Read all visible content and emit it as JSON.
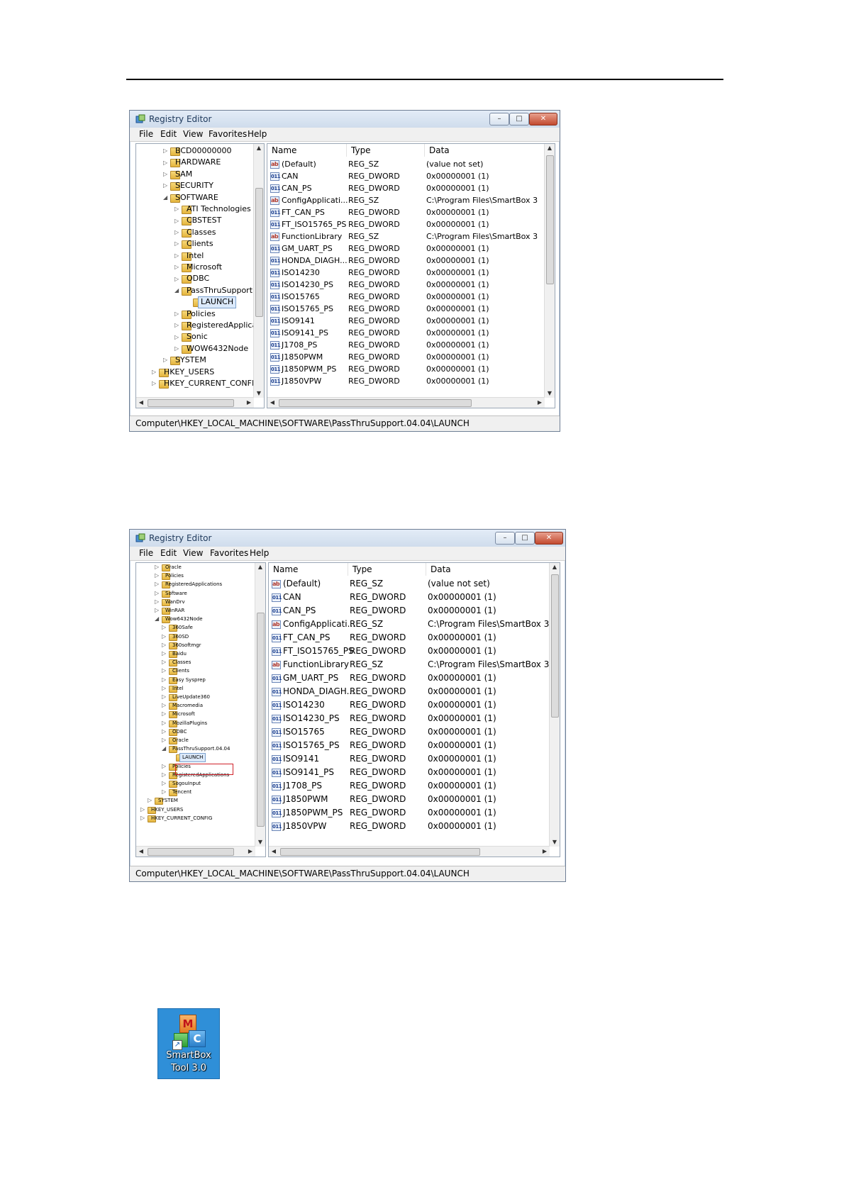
{
  "window_title": "Registry Editor",
  "window_buttons": {
    "minimize": "–",
    "maximize": "□",
    "close": "✕"
  },
  "menu": [
    "File",
    "Edit",
    "View",
    "Favorites",
    "Help"
  ],
  "columns": {
    "name": "Name",
    "type": "Type",
    "data": "Data"
  },
  "values": [
    {
      "name": "(Default)",
      "type": "REG_SZ",
      "data": "(value not set)",
      "icon": "ab"
    },
    {
      "name": "CAN",
      "type": "REG_DWORD",
      "data": "0x00000001 (1)",
      "icon": "dword"
    },
    {
      "name": "CAN_PS",
      "type": "REG_DWORD",
      "data": "0x00000001 (1)",
      "icon": "dword"
    },
    {
      "name": "ConfigApplicati...",
      "type": "REG_SZ",
      "data": "C:\\Program Files\\SmartBox 3",
      "icon": "ab"
    },
    {
      "name": "FT_CAN_PS",
      "type": "REG_DWORD",
      "data": "0x00000001 (1)",
      "icon": "dword"
    },
    {
      "name": "FT_ISO15765_PS",
      "type": "REG_DWORD",
      "data": "0x00000001 (1)",
      "icon": "dword"
    },
    {
      "name": "FunctionLibrary",
      "type": "REG_SZ",
      "data": "C:\\Program Files\\SmartBox 3",
      "icon": "ab"
    },
    {
      "name": "GM_UART_PS",
      "type": "REG_DWORD",
      "data": "0x00000001 (1)",
      "icon": "dword"
    },
    {
      "name": "HONDA_DIAGH...",
      "type": "REG_DWORD",
      "data": "0x00000001 (1)",
      "icon": "dword"
    },
    {
      "name": "ISO14230",
      "type": "REG_DWORD",
      "data": "0x00000001 (1)",
      "icon": "dword"
    },
    {
      "name": "ISO14230_PS",
      "type": "REG_DWORD",
      "data": "0x00000001 (1)",
      "icon": "dword"
    },
    {
      "name": "ISO15765",
      "type": "REG_DWORD",
      "data": "0x00000001 (1)",
      "icon": "dword"
    },
    {
      "name": "ISO15765_PS",
      "type": "REG_DWORD",
      "data": "0x00000001 (1)",
      "icon": "dword"
    },
    {
      "name": "ISO9141",
      "type": "REG_DWORD",
      "data": "0x00000001 (1)",
      "icon": "dword"
    },
    {
      "name": "ISO9141_PS",
      "type": "REG_DWORD",
      "data": "0x00000001 (1)",
      "icon": "dword"
    },
    {
      "name": "J1708_PS",
      "type": "REG_DWORD",
      "data": "0x00000001 (1)",
      "icon": "dword"
    },
    {
      "name": "J1850PWM",
      "type": "REG_DWORD",
      "data": "0x00000001 (1)",
      "icon": "dword"
    },
    {
      "name": "J1850PWM_PS",
      "type": "REG_DWORD",
      "data": "0x00000001 (1)",
      "icon": "dword"
    },
    {
      "name": "J1850VPW",
      "type": "REG_DWORD",
      "data": "0x00000001 (1)",
      "icon": "dword"
    }
  ],
  "tree1": [
    {
      "label": "BCD00000000",
      "depth": 2
    },
    {
      "label": "HARDWARE",
      "depth": 2
    },
    {
      "label": "SAM",
      "depth": 2
    },
    {
      "label": "SECURITY",
      "depth": 2
    },
    {
      "label": "SOFTWARE",
      "depth": 2
    },
    {
      "label": "ATI Technologies",
      "depth": 3
    },
    {
      "label": "CBSTEST",
      "depth": 3
    },
    {
      "label": "Classes",
      "depth": 3
    },
    {
      "label": "Clients",
      "depth": 3
    },
    {
      "label": "Intel",
      "depth": 3
    },
    {
      "label": "Microsoft",
      "depth": 3
    },
    {
      "label": "ODBC",
      "depth": 3
    },
    {
      "label": "PassThruSupport.(",
      "depth": 3
    },
    {
      "label": "LAUNCH",
      "depth": 4
    },
    {
      "label": "Policies",
      "depth": 3
    },
    {
      "label": "RegisteredApplica",
      "depth": 3
    },
    {
      "label": "Sonic",
      "depth": 3
    },
    {
      "label": "WOW6432Node",
      "depth": 3
    },
    {
      "label": "SYSTEM",
      "depth": 2
    },
    {
      "label": "HKEY_USERS",
      "depth": 1
    },
    {
      "label": "HKEY_CURRENT_CONFIG",
      "depth": 1
    }
  ],
  "tree2": [
    {
      "label": "Oracle",
      "depth": 2
    },
    {
      "label": "Policies",
      "depth": 2
    },
    {
      "label": "RegisteredApplications",
      "depth": 2
    },
    {
      "label": "Software",
      "depth": 2
    },
    {
      "label": "WanDrv",
      "depth": 2
    },
    {
      "label": "WinRAR",
      "depth": 2
    },
    {
      "label": "Wow6432Node",
      "depth": 2
    },
    {
      "label": "360Safe",
      "depth": 3
    },
    {
      "label": "360SD",
      "depth": 3
    },
    {
      "label": "360softmgr",
      "depth": 3
    },
    {
      "label": "Baidu",
      "depth": 3
    },
    {
      "label": "Classes",
      "depth": 3
    },
    {
      "label": "Clients",
      "depth": 3
    },
    {
      "label": "Easy Sysprep",
      "depth": 3
    },
    {
      "label": "Intel",
      "depth": 3
    },
    {
      "label": "LiveUpdate360",
      "depth": 3
    },
    {
      "label": "Macromedia",
      "depth": 3
    },
    {
      "label": "Microsoft",
      "depth": 3
    },
    {
      "label": "MozillaPlugins",
      "depth": 3
    },
    {
      "label": "ODBC",
      "depth": 3
    },
    {
      "label": "Oracle",
      "depth": 3
    },
    {
      "label": "PassThruSupport.04.04",
      "depth": 3
    },
    {
      "label": "LAUNCH",
      "depth": 4
    },
    {
      "label": "Policies",
      "depth": 3
    },
    {
      "label": "RegisteredApplications",
      "depth": 3
    },
    {
      "label": "SogouInput",
      "depth": 3
    },
    {
      "label": "Tencent",
      "depth": 3
    },
    {
      "label": "SYSTEM",
      "depth": 1
    },
    {
      "label": "HKEY_USERS",
      "depth": 0
    },
    {
      "label": "HKEY_CURRENT_CONFIG",
      "depth": 0
    }
  ],
  "statusbar": "Computer\\HKEY_LOCAL_MACHINE\\SOFTWARE\\PassThruSupport.04.04\\LAUNCH",
  "scroll_grip": "|||",
  "desktop_icon": {
    "line1": "SmartBox",
    "line2": "Tool 3.0",
    "m": "M",
    "c": "C"
  }
}
